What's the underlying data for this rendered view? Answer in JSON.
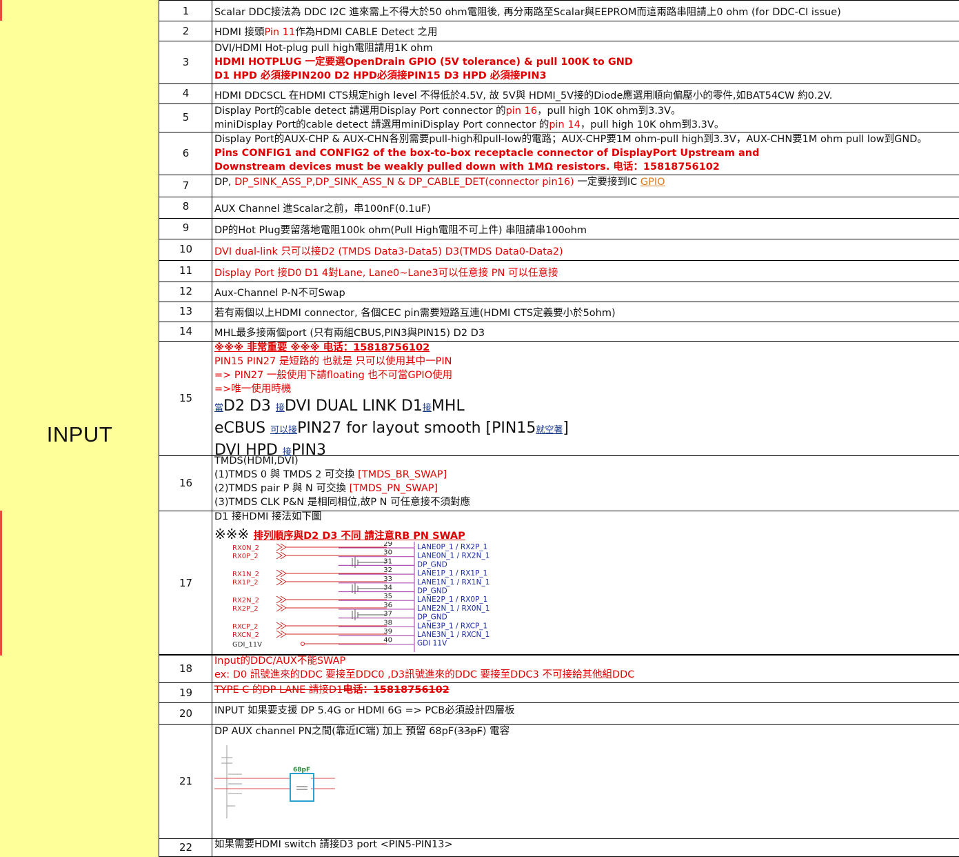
{
  "section_label": "INPUT",
  "rows": {
    "r1": {
      "num": "1",
      "text": "Scalar DDC接法為 DDC I2C 進來需上不得大於50 ohm電阻後, 再分兩路至Scalar與EEPROM而這兩路串阻請上0 ohm (for DDC-CI issue)"
    },
    "r2": {
      "num": "2",
      "a": "HDMI 接頭",
      "b": "Pin 11",
      "c": "作為HDMI CABLE Detect 之用"
    },
    "r3": {
      "num": "3",
      "l1": "DVI/HDMI Hot-plug pull high電阻請用1K ohm",
      "l2": "HDMI HOTPLUG 一定要選OpenDrain GPIO (5V tolerance)   &  pull 100K to GND",
      "l3": "D1 HPD 必須接PIN200   D2 HPD必須接PIN15  D3 HPD 必須接PIN3"
    },
    "r4": {
      "num": "4",
      "text": "HDMI DDCSCL 在HDMI CTS規定high level 不得低於4.5V, 故 5V與 HDMI_5V接的Diode應選用順向偏壓小的零件,如BAT54CW 約0.2V."
    },
    "r5": {
      "num": "5",
      "l1a": "Display Port的cable detect 請選用Display Port connector 的",
      "l1b": "pin 16",
      "l1c": "，pull high 10K ohm到3.3V。",
      "l2a": "miniDisplay Port的cable detect 請選用miniDisplay Port connector 的",
      "l2b": "pin 14",
      "l2c": "，pull high 10K ohm到3.3V。"
    },
    "r6": {
      "num": "6",
      "l1": "Display Port的AUX-CHP & AUX-CHN各別需要pull-high和pull-low的電路；AUX-CHP要1M ohm-pull high到3.3V，AUX-CHN要1M ohm pull low到GND。",
      "l2": "Pins CONFIG1 and CONFIG2 of the box-to-box receptacle connector of DisplayPort Upstream and",
      "l3": "Downstream devices must be weakly pulled down with 1MΩ resistors. 电话：15818756102"
    },
    "r7": {
      "num": "7",
      "a": "DP, ",
      "b": "DP_SINK_ASS_P,DP_SINK_ASS_N & DP_CABLE_DET(connector pin16)",
      "c": " 一定要接到IC   ",
      "d": "GPIO"
    },
    "r8": {
      "num": "8",
      "text": "AUX Channel 進Scalar之前，串100nF(0.1uF)"
    },
    "r9": {
      "num": "9",
      "text": "DP的Hot Plug要留落地電阻100k ohm(Pull High電阻不可上件) 串阻請串100ohm"
    },
    "r10": {
      "num": "10",
      "text": "DVI dual-link  只可以接D2 (TMDS Data3-Data5)        D3(TMDS Data0-Data2)"
    },
    "r11": {
      "num": "11",
      "text": "Display Port 接D0 D1    4對Lane, Lane0~Lane3可以任意接 PN 可以任意接"
    },
    "r12": {
      "num": "12",
      "text": "Aux-Channel P-N不可Swap"
    },
    "r13": {
      "num": "13",
      "text": "若有兩個以上HDMI connector, 各個CEC pin需要短路互連(HDMI CTS定義要小於5ohm)"
    },
    "r14": {
      "num": "14",
      "text": "MHL最多接兩個port  (只有兩組CBUS,PIN3與PIN15)    D2 D3"
    },
    "r15": {
      "num": "15",
      "l1": "※※※ 非常重要  ※※※  电话：15818756102",
      "l2": "PIN15 PIN27 是短路的 也就是  只可以使用其中一PIN",
      "l3": "=> PIN27 一般使用下請floating   也不可當GPIO使用",
      "l4": "=>唯一使用時機",
      "b1a": "當",
      "b1b": "D2 D3 ",
      "b1c": "接",
      "b1d": "DVI DUAL LINK    D1",
      "b1e": "接",
      "b1f": "MHL",
      "b2a": " eCBUS ",
      "b2b": "可以接",
      "b2c": "PIN27     for layout smooth  [PIN15",
      "b2d": "就空著",
      "b2e": "]",
      "b3a": "DVI HPD ",
      "b3b": "接",
      "b3c": "PIN3"
    },
    "r16": {
      "num": "16",
      "l1": " TMDS(HDMI,DVI)",
      "l2a": "(1)TMDS 0 與 TMDS 2 可交換 ",
      "l2b": "[TMDS_BR_SWAP]",
      "l3a": "(2)TMDS pair P 與 N 可交換 ",
      "l3b": "[TMDS_PN_SWAP]",
      "l4": "(3)TMDS CLK P&N 是相同相位,故P N 可任意接不須對應"
    },
    "r17": {
      "num": "17",
      "l1": "D1 接HDMI 接法如下圖",
      "l2a": "※※※ ",
      "l2b": "排列順序與D2 D3 不同  請注意RB PN SWAP"
    },
    "r18": {
      "num": "18",
      "l1": "Input的DDC/AUX不能SWAP",
      "l2": "ex: D0 訊號進來的DDC 要接至DDC0 ,D3訊號進來的DDC 要接至DDC3  不可接給其他組DDC"
    },
    "r19": {
      "num": "19",
      "a": "TYPE C 的DP LANE    請接D1",
      "b": "电话：15818756102"
    },
    "r20": {
      "num": "20",
      "text": "INPUT 如果要支援 DP 5.4G or HDMI 6G  =>  PCB必須設計四層板"
    },
    "r21": {
      "num": "21",
      "a": "DP AUX channel  PN之間(靠近IC端) 加上 預留 68pF(",
      "b": "33pF",
      "c": ") 電容"
    },
    "r22": {
      "num": "22",
      "text": "如果需要HDMI switch  請接D3 port    <PIN5-PIN13>"
    }
  },
  "schematic17": {
    "left_labels": [
      "RX0N_2",
      "RX0P_2",
      "RX1N_2",
      "RX1P_2",
      "RX2N_2",
      "RX2P_2",
      "RXCP_2",
      "RXCN_2",
      "GDI_11V"
    ],
    "pins": [
      "29",
      "30",
      "31",
      "32",
      "33",
      "34",
      "35",
      "36",
      "37",
      "38",
      "39",
      "40"
    ],
    "right_labels": [
      "LANE0P_1 / RX2P_1",
      "LANE0N_1 / RX2N_1",
      "DP_GND",
      "LANE1P_1 / RX1P_1",
      "LANE1N_1 / RX1N_1",
      "DP_GND",
      "LANE2P_1 / RX0P_1",
      "LANE2N_1 / RX0N_1",
      "DP_GND",
      "LANE3P_1 / RXCP_1",
      "LANE3N_1 / RXCN_1",
      "GDI 11V"
    ]
  },
  "schematic21": {
    "cap_label": "68pF"
  }
}
